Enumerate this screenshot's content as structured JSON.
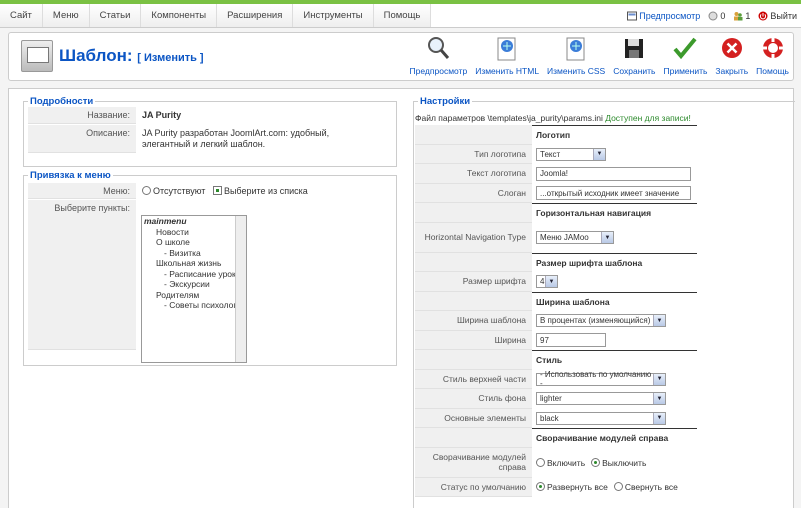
{
  "menu": [
    "Сайт",
    "Меню",
    "Статьи",
    "Компоненты",
    "Расширения",
    "Инструменты",
    "Помощь"
  ],
  "status": {
    "preview": "Предпросмотр",
    "messages": "0",
    "users": "1",
    "logout": "Выйти"
  },
  "header": {
    "title": "Шаблон:",
    "subtitle": "[ Изменить ]"
  },
  "toolbar": [
    "Предпросмотр",
    "Изменить HTML",
    "Изменить CSS",
    "Сохранить",
    "Применить",
    "Закрыть",
    "Помощь"
  ],
  "details": {
    "legend": "Подробности",
    "name_label": "Название:",
    "name_value": "JA Purity",
    "desc_label": "Описание:",
    "desc_value": "JA Purity разработан JoomlArt.com: удобный, элегантный и легкий шаблон."
  },
  "menu_binding": {
    "legend": "Привязка к меню",
    "menus_label": "Меню:",
    "opt_none": "Отсутствуют",
    "opt_select": "Выберите из списка",
    "items_label": "Выберите пункты:",
    "items": [
      "mainmenu",
      "Новости",
      "О школе",
      "- Визитка",
      "Школьная жизнь",
      "- Расписание уроков",
      "- Экскурсии",
      "Родителям",
      "- Советы психолога"
    ]
  },
  "settings": {
    "legend": "Настройки",
    "path": "Файл параметров \\templates\\ja_purity\\params.ini",
    "writable": "Доступен для записи!",
    "rows": [
      {
        "type": "section",
        "label": "Логотип"
      },
      {
        "type": "select",
        "label": "Тип логотипа",
        "value": "Текст",
        "w": 70
      },
      {
        "type": "text",
        "label": "Текст логотипа",
        "value": "Joomla!",
        "w": 155
      },
      {
        "type": "text",
        "label": "Слоган",
        "value": "...открытый исходник имеет значение",
        "w": 155
      },
      {
        "type": "section",
        "label": "Горизонтальная навигация"
      },
      {
        "type": "select",
        "label": "Horizontal Navigation Type",
        "value": "Меню JAMoo",
        "w": 78,
        "tall": true
      },
      {
        "type": "section",
        "label": "Размер шрифта шаблона"
      },
      {
        "type": "select",
        "label": "Размер шрифта",
        "value": "4",
        "w": 22
      },
      {
        "type": "section",
        "label": "Ширина шаблона"
      },
      {
        "type": "select",
        "label": "Ширина шаблона",
        "value": "В процентах (изменяющийся)",
        "w": 130
      },
      {
        "type": "text",
        "label": "Ширина",
        "value": "97",
        "w": 70
      },
      {
        "type": "section",
        "label": "Стиль"
      },
      {
        "type": "select",
        "label": "Стиль верхней части",
        "value": "- Использовать по умолчанию -",
        "w": 130
      },
      {
        "type": "select",
        "label": "Стиль фона",
        "value": "lighter",
        "w": 130
      },
      {
        "type": "select",
        "label": "Основные элементы",
        "value": "black",
        "w": 130
      },
      {
        "type": "section",
        "label": "Сворачивание модулей справа"
      },
      {
        "type": "radio",
        "label": "Сворачивание модулей справа",
        "opt1": "Включить",
        "opt2": "Выключить",
        "sel": 2,
        "tall": true
      },
      {
        "type": "radio",
        "label": "Статус по умолчанию",
        "opt1": "Развернуть все",
        "opt2": "Свернуть все",
        "sel": 1
      }
    ]
  }
}
